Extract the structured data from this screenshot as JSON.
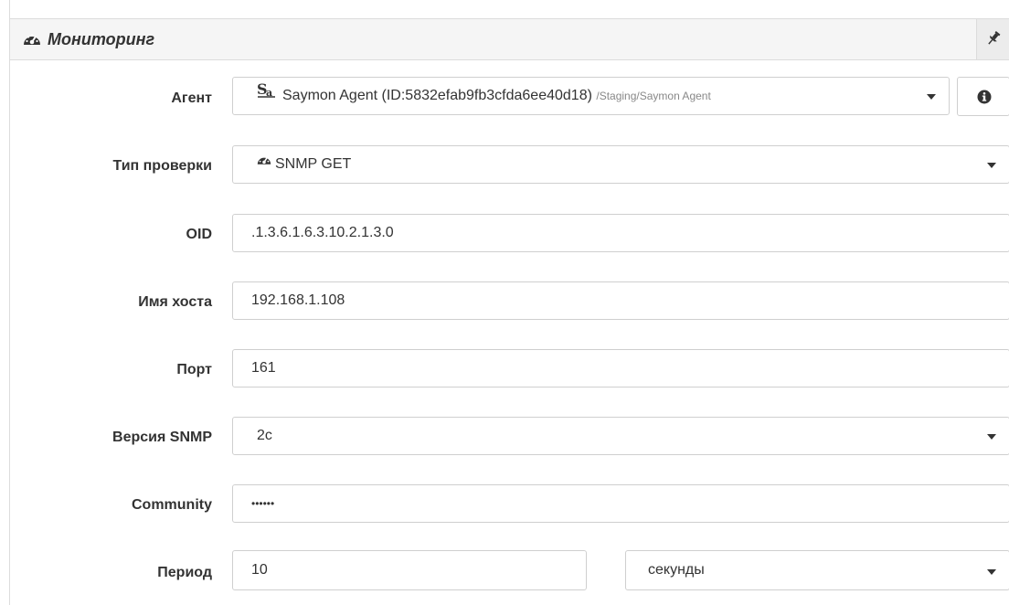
{
  "panel": {
    "title": "Мониторинг",
    "icon": "dashboard-icon",
    "pin_icon": "pin-icon"
  },
  "form": {
    "agent": {
      "label": "Агент",
      "value": "Saymon Agent (ID:5832efab9fb3cfda6ee40d18)",
      "path": "/Staging/Saymon Agent",
      "icon": "agent-icon",
      "info_icon": "info-icon"
    },
    "check_type": {
      "label": "Тип проверки",
      "value": "SNMP GET",
      "icon": "dashboard-icon"
    },
    "oid": {
      "label": "OID",
      "value": ".1.3.6.1.6.3.10.2.1.3.0"
    },
    "hostname": {
      "label": "Имя хоста",
      "value": "192.168.1.108"
    },
    "port": {
      "label": "Порт",
      "value": "161"
    },
    "snmp_version": {
      "label": "Версия SNMP",
      "value": "2c"
    },
    "community": {
      "label": "Community",
      "value": "••••••"
    },
    "period": {
      "label": "Период",
      "value": "10",
      "unit": "секунды"
    }
  }
}
